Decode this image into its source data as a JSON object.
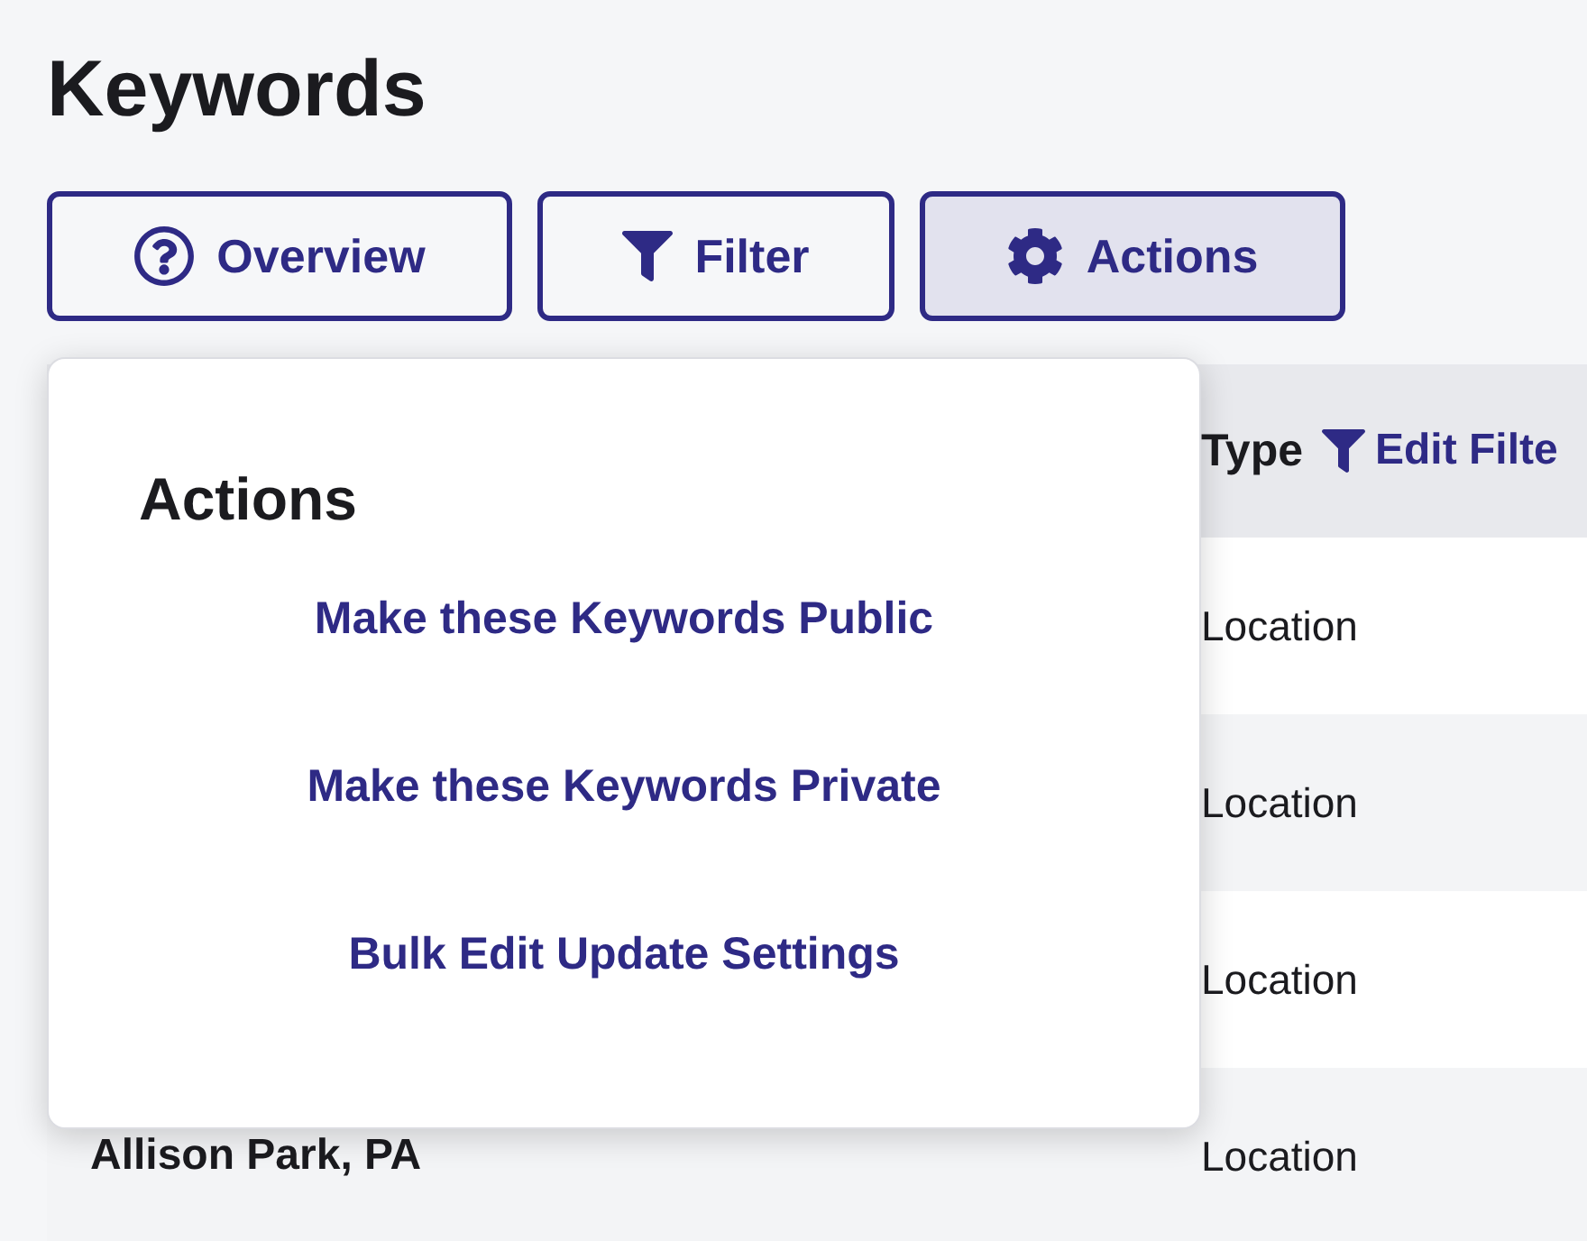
{
  "page": {
    "title": "Keywords"
  },
  "toolbar": [
    {
      "kind": "help",
      "label": "Overview",
      "selected": false
    },
    {
      "kind": "filter",
      "label": "Filter",
      "selected": false
    },
    {
      "kind": "settings",
      "label": "Actions",
      "selected": true
    }
  ],
  "table": {
    "type_header": "Type",
    "edit_filter": "Edit Filte",
    "rows": [
      {
        "type": "Location"
      },
      {
        "type": "Location"
      },
      {
        "type": "Location"
      },
      {
        "keyword": "Allison Park, PA",
        "type": "Location"
      }
    ]
  },
  "actions_menu": {
    "title": "Actions",
    "items": [
      "Make these Keywords Public",
      "Make these Keywords Private",
      "Bulk Edit Update Settings"
    ]
  }
}
